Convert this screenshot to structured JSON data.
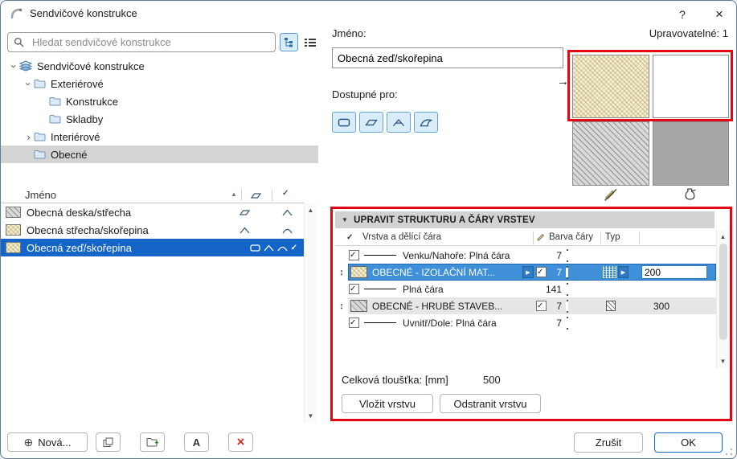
{
  "window": {
    "title": "Sendvičové konstrukce"
  },
  "icons": {
    "help": "?",
    "close": "×",
    "chevron": "›",
    "sort_asc": "▲",
    "arrow_up": "▲",
    "arrow_down": "▼",
    "collapse": "▼",
    "plus_circle": "⊕",
    "delete_x": "×",
    "check": "✓",
    "play": "▶",
    "ref_arrow": "→",
    "drag": "↕",
    "rename_letter": "A"
  },
  "search": {
    "placeholder": "Hledat sendvičové konstrukce"
  },
  "tree": {
    "items": [
      {
        "label": "Sendvičové konstrukce"
      },
      {
        "label": "Exteriérové"
      },
      {
        "label": "Konstrukce"
      },
      {
        "label": "Skladby"
      },
      {
        "label": "Interiérové"
      },
      {
        "label": "Obecné"
      }
    ]
  },
  "list": {
    "name_header": "Jméno",
    "rows": [
      {
        "name": "Obecná deska/střecha"
      },
      {
        "name": "Obecná střecha/skořepina"
      },
      {
        "name": "Obecná zeď/skořepina"
      }
    ]
  },
  "left_footer": {
    "new_label": "Nová..."
  },
  "name_field": {
    "label": "Jméno:",
    "value": "Obecná zeď/skořepina"
  },
  "available_for": {
    "label": "Dostupné pro:"
  },
  "editable": {
    "text": "Upravovatelné: 1"
  },
  "section": {
    "title": "UPRAVIT STRUKTURU A ČÁRY VRSTEV"
  },
  "layers": {
    "headers": {
      "layer": "Vrstva a dělící čára",
      "color": "Barva čáry",
      "type": "Typ"
    },
    "rows": [
      {
        "kind": "separator",
        "label": "Venku/Nahoře: Plná čára",
        "pen": "7"
      },
      {
        "kind": "layer",
        "label": "OBECNÉ - IZOLAČNÍ MAT...",
        "pen": "7",
        "thickness": "200"
      },
      {
        "kind": "separator",
        "label": "Plná čára",
        "pen": "141"
      },
      {
        "kind": "layer",
        "label": "OBECNÉ - HRUBÉ STAVEB...",
        "pen": "7",
        "thickness": "300"
      },
      {
        "kind": "separator",
        "label": "Uvnitř/Dole: Plná čára",
        "pen": "7"
      }
    ],
    "total_label": "Celková tloušťka: [mm]",
    "total_value": "500",
    "insert_label": "Vložit vrstvu",
    "remove_label": "Odstranit vrstvu"
  },
  "dialog_buttons": {
    "cancel": "Zrušit",
    "ok": "OK"
  },
  "colors": {
    "list_selection_blue": "#1565c8",
    "row_selected_blue": "#3f8fd9",
    "accent_blue": "#0f6cbd",
    "annotation_red": "#e30613",
    "toggle_bg": "#d9ecfa"
  }
}
